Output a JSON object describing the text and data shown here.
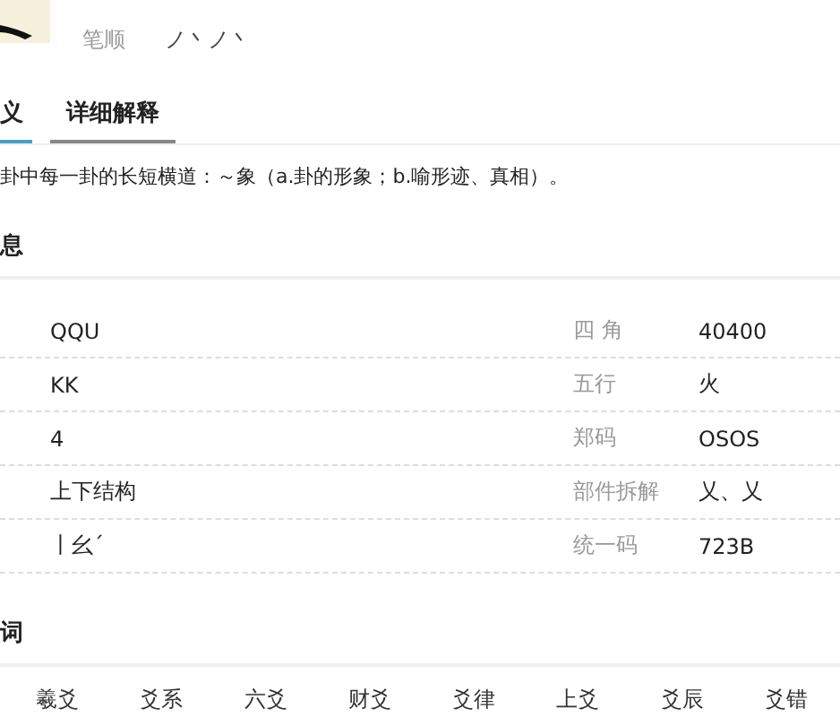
{
  "header": {
    "fields": [
      {
        "label": "笔顺",
        "value": "ノ丶ノ丶"
      }
    ]
  },
  "tabs": [
    {
      "label": "义",
      "selected": true
    },
    {
      "label": "详细解释",
      "selected": false
    }
  ],
  "definition": "卦中每一卦的长短横道：～象（a.卦的形象；b.喻形迹、真相）。",
  "info": {
    "heading": "息",
    "rows": [
      {
        "value": "QQU",
        "label_2": "四 角",
        "value_2": "40400"
      },
      {
        "value": "KK",
        "label_2": "五行",
        "value_2": "火"
      },
      {
        "value": "4",
        "label_2": "郑码",
        "value_2": "OSOS"
      },
      {
        "value": "上下结构",
        "label_2": "部件拆解",
        "value_2": "乂、乂"
      },
      {
        "value": "丨幺ˊ",
        "label_2": "统一码",
        "value_2": "723B"
      }
    ]
  },
  "words": {
    "heading": "词",
    "items": [
      "羲爻",
      "爻系",
      "六爻",
      "财爻",
      "爻律",
      "上爻",
      "爻辰",
      "爻错"
    ]
  }
}
